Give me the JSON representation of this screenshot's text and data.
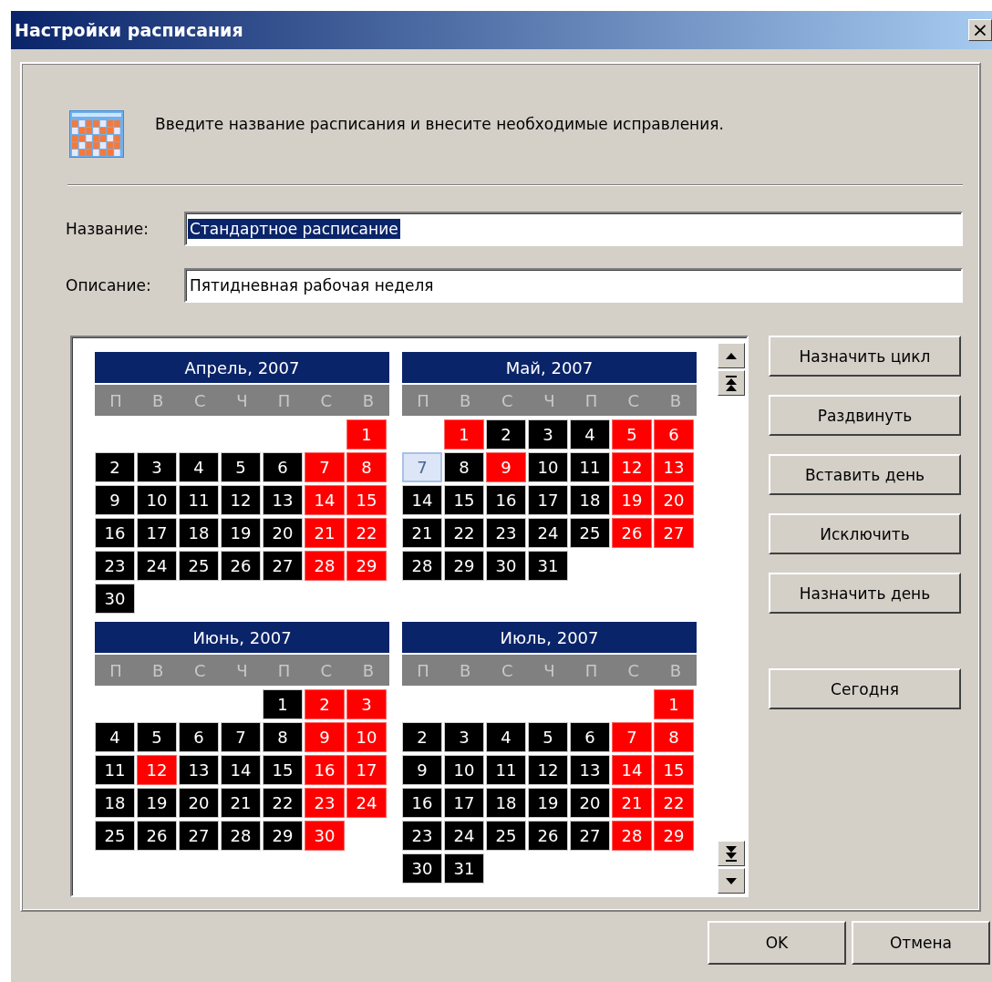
{
  "window": {
    "title": "Настройки расписания",
    "close": "×"
  },
  "header": {
    "text": "Введите название расписания и внесите необходимые исправления."
  },
  "fields": [
    {
      "label": "Название:",
      "value": "Стандартное расписание",
      "selected": true
    },
    {
      "label": "Описание:",
      "value": "Пятидневная рабочая неделя",
      "selected": false
    }
  ],
  "calendar": {
    "months": [
      {
        "title": "Апрель, 2007",
        "weekdays": [
          "П",
          "В",
          "С",
          "Ч",
          "П",
          "С",
          "В"
        ],
        "weeks": [
          [
            {
              "day": "1",
              "kind": "holiday",
              "selected": false
            }
          ],
          [
            {
              "day": "2",
              "kind": "work",
              "selected": false
            },
            {
              "day": "3",
              "kind": "work",
              "selected": false
            },
            {
              "day": "4",
              "kind": "work",
              "selected": false
            },
            {
              "day": "5",
              "kind": "work",
              "selected": false
            },
            {
              "day": "6",
              "kind": "work",
              "selected": false
            },
            {
              "day": "7",
              "kind": "holiday",
              "selected": false
            },
            {
              "day": "8",
              "kind": "holiday",
              "selected": false
            }
          ],
          [
            {
              "day": "9",
              "kind": "work",
              "selected": false
            },
            {
              "day": "10",
              "kind": "work",
              "selected": false
            },
            {
              "day": "11",
              "kind": "work",
              "selected": false
            },
            {
              "day": "12",
              "kind": "work",
              "selected": false
            },
            {
              "day": "13",
              "kind": "work",
              "selected": false
            },
            {
              "day": "14",
              "kind": "holiday",
              "selected": false
            },
            {
              "day": "15",
              "kind": "holiday",
              "selected": false
            }
          ],
          [
            {
              "day": "16",
              "kind": "work",
              "selected": false
            },
            {
              "day": "17",
              "kind": "work",
              "selected": false
            },
            {
              "day": "18",
              "kind": "work",
              "selected": false
            },
            {
              "day": "19",
              "kind": "work",
              "selected": false
            },
            {
              "day": "20",
              "kind": "work",
              "selected": false
            },
            {
              "day": "21",
              "kind": "holiday",
              "selected": false
            },
            {
              "day": "22",
              "kind": "holiday",
              "selected": false
            }
          ],
          [
            {
              "day": "23",
              "kind": "work",
              "selected": false
            },
            {
              "day": "24",
              "kind": "work",
              "selected": false
            },
            {
              "day": "25",
              "kind": "work",
              "selected": false
            },
            {
              "day": "26",
              "kind": "work",
              "selected": false
            },
            {
              "day": "27",
              "kind": "work",
              "selected": false
            },
            {
              "day": "28",
              "kind": "holiday",
              "selected": false
            },
            {
              "day": "29",
              "kind": "holiday",
              "selected": false
            }
          ],
          [
            {
              "day": "30",
              "kind": "work",
              "selected": false
            }
          ]
        ]
      },
      {
        "title": "Май, 2007",
        "weekdays": [
          "П",
          "В",
          "С",
          "Ч",
          "П",
          "С",
          "В"
        ],
        "weeks": [
          [
            {
              "day": "1",
              "kind": "holiday",
              "selected": false
            },
            {
              "day": "2",
              "kind": "work",
              "selected": false
            },
            {
              "day": "3",
              "kind": "work",
              "selected": false
            },
            {
              "day": "4",
              "kind": "work",
              "selected": false
            },
            {
              "day": "5",
              "kind": "holiday",
              "selected": false
            },
            {
              "day": "6",
              "kind": "holiday",
              "selected": false
            }
          ],
          [
            {
              "day": "7",
              "kind": "work",
              "selected": true
            },
            {
              "day": "8",
              "kind": "work",
              "selected": false
            },
            {
              "day": "9",
              "kind": "holiday",
              "selected": false
            },
            {
              "day": "10",
              "kind": "work",
              "selected": false
            },
            {
              "day": "11",
              "kind": "work",
              "selected": false
            },
            {
              "day": "12",
              "kind": "holiday",
              "selected": false
            },
            {
              "day": "13",
              "kind": "holiday",
              "selected": false
            }
          ],
          [
            {
              "day": "14",
              "kind": "work",
              "selected": false
            },
            {
              "day": "15",
              "kind": "work",
              "selected": false
            },
            {
              "day": "16",
              "kind": "work",
              "selected": false
            },
            {
              "day": "17",
              "kind": "work",
              "selected": false
            },
            {
              "day": "18",
              "kind": "work",
              "selected": false
            },
            {
              "day": "19",
              "kind": "holiday",
              "selected": false
            },
            {
              "day": "20",
              "kind": "holiday",
              "selected": false
            }
          ],
          [
            {
              "day": "21",
              "kind": "work",
              "selected": false
            },
            {
              "day": "22",
              "kind": "work",
              "selected": false
            },
            {
              "day": "23",
              "kind": "work",
              "selected": false
            },
            {
              "day": "24",
              "kind": "work",
              "selected": false
            },
            {
              "day": "25",
              "kind": "work",
              "selected": false
            },
            {
              "day": "26",
              "kind": "holiday",
              "selected": false
            },
            {
              "day": "27",
              "kind": "holiday",
              "selected": false
            }
          ],
          [
            {
              "day": "28",
              "kind": "work",
              "selected": false
            },
            {
              "day": "29",
              "kind": "work",
              "selected": false
            },
            {
              "day": "30",
              "kind": "work",
              "selected": false
            },
            {
              "day": "31",
              "kind": "work",
              "selected": false
            }
          ]
        ]
      },
      {
        "title": "Июнь, 2007",
        "weekdays": [
          "П",
          "В",
          "С",
          "Ч",
          "П",
          "С",
          "В"
        ],
        "weeks": [
          [
            {
              "day": "1",
              "kind": "work",
              "selected": false
            },
            {
              "day": "2",
              "kind": "holiday",
              "selected": false
            },
            {
              "day": "3",
              "kind": "holiday",
              "selected": false
            }
          ],
          [
            {
              "day": "4",
              "kind": "work",
              "selected": false
            },
            {
              "day": "5",
              "kind": "work",
              "selected": false
            },
            {
              "day": "6",
              "kind": "work",
              "selected": false
            },
            {
              "day": "7",
              "kind": "work",
              "selected": false
            },
            {
              "day": "8",
              "kind": "work",
              "selected": false
            },
            {
              "day": "9",
              "kind": "holiday",
              "selected": false
            },
            {
              "day": "10",
              "kind": "holiday",
              "selected": false
            }
          ],
          [
            {
              "day": "11",
              "kind": "work",
              "selected": false
            },
            {
              "day": "12",
              "kind": "holiday",
              "selected": false
            },
            {
              "day": "13",
              "kind": "work",
              "selected": false
            },
            {
              "day": "14",
              "kind": "work",
              "selected": false
            },
            {
              "day": "15",
              "kind": "work",
              "selected": false
            },
            {
              "day": "16",
              "kind": "holiday",
              "selected": false
            },
            {
              "day": "17",
              "kind": "holiday",
              "selected": false
            }
          ],
          [
            {
              "day": "18",
              "kind": "work",
              "selected": false
            },
            {
              "day": "19",
              "kind": "work",
              "selected": false
            },
            {
              "day": "20",
              "kind": "work",
              "selected": false
            },
            {
              "day": "21",
              "kind": "work",
              "selected": false
            },
            {
              "day": "22",
              "kind": "work",
              "selected": false
            },
            {
              "day": "23",
              "kind": "holiday",
              "selected": false
            },
            {
              "day": "24",
              "kind": "holiday",
              "selected": false
            }
          ],
          [
            {
              "day": "25",
              "kind": "work",
              "selected": false
            },
            {
              "day": "26",
              "kind": "work",
              "selected": false
            },
            {
              "day": "27",
              "kind": "work",
              "selected": false
            },
            {
              "day": "28",
              "kind": "work",
              "selected": false
            },
            {
              "day": "29",
              "kind": "work",
              "selected": false
            },
            {
              "day": "30",
              "kind": "holiday",
              "selected": false
            }
          ]
        ]
      },
      {
        "title": "Июль, 2007",
        "weekdays": [
          "П",
          "В",
          "С",
          "Ч",
          "П",
          "С",
          "В"
        ],
        "weeks": [
          [
            {
              "day": "1",
              "kind": "holiday",
              "selected": false
            }
          ],
          [
            {
              "day": "2",
              "kind": "work",
              "selected": false
            },
            {
              "day": "3",
              "kind": "work",
              "selected": false
            },
            {
              "day": "4",
              "kind": "work",
              "selected": false
            },
            {
              "day": "5",
              "kind": "work",
              "selected": false
            },
            {
              "day": "6",
              "kind": "work",
              "selected": false
            },
            {
              "day": "7",
              "kind": "holiday",
              "selected": false
            },
            {
              "day": "8",
              "kind": "holiday",
              "selected": false
            }
          ],
          [
            {
              "day": "9",
              "kind": "work",
              "selected": false
            },
            {
              "day": "10",
              "kind": "work",
              "selected": false
            },
            {
              "day": "11",
              "kind": "work",
              "selected": false
            },
            {
              "day": "12",
              "kind": "work",
              "selected": false
            },
            {
              "day": "13",
              "kind": "work",
              "selected": false
            },
            {
              "day": "14",
              "kind": "holiday",
              "selected": false
            },
            {
              "day": "15",
              "kind": "holiday",
              "selected": false
            }
          ],
          [
            {
              "day": "16",
              "kind": "work",
              "selected": false
            },
            {
              "day": "17",
              "kind": "work",
              "selected": false
            },
            {
              "day": "18",
              "kind": "work",
              "selected": false
            },
            {
              "day": "19",
              "kind": "work",
              "selected": false
            },
            {
              "day": "20",
              "kind": "work",
              "selected": false
            },
            {
              "day": "21",
              "kind": "holiday",
              "selected": false
            },
            {
              "day": "22",
              "kind": "holiday",
              "selected": false
            }
          ],
          [
            {
              "day": "23",
              "kind": "work",
              "selected": false
            },
            {
              "day": "24",
              "kind": "work",
              "selected": false
            },
            {
              "day": "25",
              "kind": "work",
              "selected": false
            },
            {
              "day": "26",
              "kind": "work",
              "selected": false
            },
            {
              "day": "27",
              "kind": "work",
              "selected": false
            },
            {
              "day": "28",
              "kind": "holiday",
              "selected": false
            },
            {
              "day": "29",
              "kind": "holiday",
              "selected": false
            }
          ],
          [
            {
              "day": "30",
              "kind": "work",
              "selected": false
            },
            {
              "day": "31",
              "kind": "work",
              "selected": false
            }
          ]
        ]
      }
    ]
  },
  "side_buttons": [
    {
      "label": "Назначить цикл",
      "kind": "action"
    },
    {
      "label": "Раздвинуть",
      "kind": "action"
    },
    {
      "label": "Вставить день",
      "kind": "action"
    },
    {
      "label": "Исключить",
      "kind": "action"
    },
    {
      "label": "Назначить день",
      "kind": "action"
    },
    {
      "label": "Сегодня",
      "kind": "separate"
    }
  ],
  "footer_buttons": [
    "OK",
    "Отмена"
  ]
}
